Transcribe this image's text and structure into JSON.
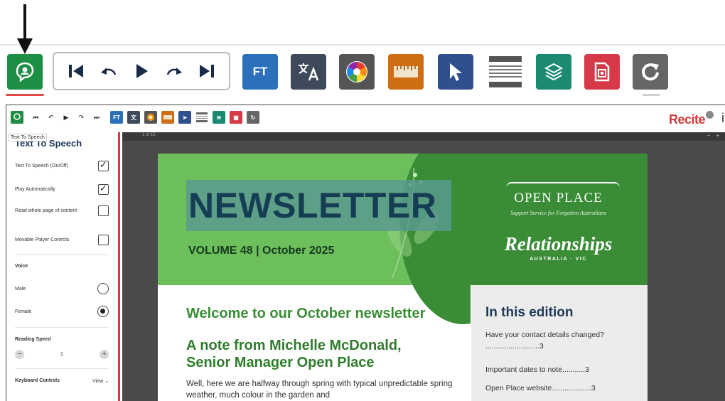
{
  "toolbar": {
    "buttons": [
      {
        "name": "text-to-speech",
        "icon": "speech-head-icon",
        "color": "#1f8e45"
      },
      {
        "name": "player-controls",
        "icons": [
          "skip-back-icon",
          "rewind-icon",
          "play-icon",
          "forward-icon",
          "skip-forward-icon"
        ]
      },
      {
        "name": "font",
        "label": "FT",
        "color": "#2b70b8"
      },
      {
        "name": "translate",
        "icon": "translate-icon",
        "color": "#3e4a5c"
      },
      {
        "name": "color",
        "icon": "color-wheel-icon",
        "color": "#555555"
      },
      {
        "name": "ruler",
        "icon": "ruler-icon",
        "color": "#cf6d12"
      },
      {
        "name": "pointer",
        "icon": "cursor-icon",
        "color": "#2f4f8f"
      },
      {
        "name": "screen-mask",
        "icon": "mask-lines-icon",
        "color": "#ffffff"
      },
      {
        "name": "simplify",
        "icon": "layers-icon",
        "color": "#1c8a73"
      },
      {
        "name": "pdf",
        "icon": "pdf-icon",
        "color": "#d63a49"
      },
      {
        "name": "reset",
        "icon": "reset-icon",
        "color": "#666666"
      }
    ]
  },
  "mini_toolbar": {
    "font_label": "FT",
    "logo": "Recite",
    "extra": "i"
  },
  "tooltip": "Text To Speech",
  "panel": {
    "title": "Text To Speech",
    "options": [
      {
        "label": "Text To Speech (On/Off)",
        "checked": true
      },
      {
        "label": "Play Automatically",
        "checked": true
      },
      {
        "label": "Read whole page of content",
        "checked": false
      },
      {
        "label": "Movable Player Controls",
        "checked": false
      }
    ],
    "voice_label": "Voice",
    "voices": [
      {
        "label": "Male",
        "selected": false
      },
      {
        "label": "Female",
        "selected": true
      }
    ],
    "speed_label": "Reading Speed",
    "speed_value": "1",
    "speed_minus": "−",
    "speed_plus": "+",
    "keyboard_label": "Keyboard Controls",
    "keyboard_action": "View ⌄"
  },
  "viewer": {
    "page_indicator": "1 of 15",
    "zoom_controls": "− +"
  },
  "newsletter": {
    "title": "NEWSLETTER",
    "volume": "VOLUME 48   |   October 2025",
    "org_name": "OPEN PLACE",
    "org_tagline": "Support Service for Forgotten Australians",
    "partner_name": "Relationships",
    "partner_sub": "AUSTRALIA · VIC",
    "welcome": "Welcome to our October newsletter",
    "note_title": "A note from Michelle McDonald, Senior Manager Open Place",
    "body": "Well, here we are halfway through spring with typical unpredictable spring weather, much colour in the garden and",
    "toc_title": "In this edition",
    "toc": [
      {
        "text": "Have your contact details changed? ",
        "page": "3"
      },
      {
        "text": "Important dates to note",
        "page": "3"
      },
      {
        "text": "Open Place website",
        "page": "3"
      }
    ]
  }
}
